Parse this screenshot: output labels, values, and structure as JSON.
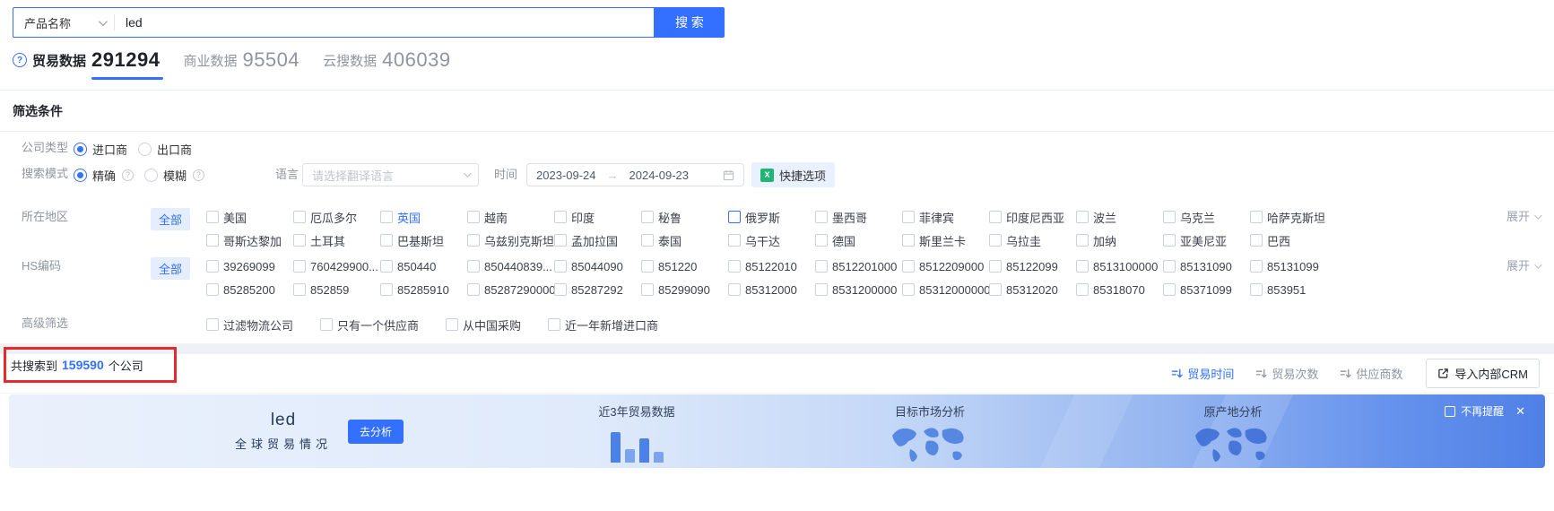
{
  "colors": {
    "primary_blue": "#3370ff",
    "annotation_red": "#e52b2b",
    "chip_bg": "#e5eefe",
    "quick_icon_green": "#21b573",
    "banner_deep_blue": "#4f80e6",
    "inactive_gray": "#8f959e"
  },
  "icons": {
    "question_circle": "?",
    "info_circle": "?",
    "excel": "X",
    "range_arrow": "→",
    "close": "✕"
  },
  "search_bar": {
    "category": "产品名称",
    "query": "led",
    "button": "搜 索"
  },
  "tabs": [
    {
      "label": "贸易数据",
      "count": "291294"
    },
    {
      "label": "商业数据",
      "count": "95504"
    },
    {
      "label": "云搜数据",
      "count": "406039"
    }
  ],
  "filters": {
    "title": "筛选条件",
    "company_type": {
      "label": "公司类型",
      "options": [
        {
          "label": "进口商",
          "cls": "on",
          "info": "hide"
        },
        {
          "label": "出口商",
          "cls": "",
          "info": "hide"
        }
      ]
    },
    "search_mode": {
      "label": "搜索模式",
      "options": [
        {
          "label": "精确",
          "cls": "on",
          "info": "show"
        },
        {
          "label": "模糊",
          "cls": "",
          "info": "show"
        }
      ]
    },
    "language": {
      "label": "语言",
      "placeholder": "请选择翻译语言"
    },
    "time": {
      "label": "时间",
      "start": "2023-09-24",
      "end": "2024-09-23"
    },
    "quick_option": "快捷选项",
    "region": {
      "label": "所在地区",
      "all": "全部",
      "expand": "展开",
      "row1": [
        {
          "label": "美国",
          "cls": ""
        },
        {
          "label": "厄瓜多尔",
          "cls": ""
        },
        {
          "label": "英国",
          "cls": "lbl-blue"
        },
        {
          "label": "越南",
          "cls": ""
        },
        {
          "label": "印度",
          "cls": ""
        },
        {
          "label": "秘鲁",
          "cls": ""
        },
        {
          "label": "俄罗斯",
          "cls": "box-blue"
        },
        {
          "label": "墨西哥",
          "cls": ""
        },
        {
          "label": "菲律宾",
          "cls": ""
        },
        {
          "label": "印度尼西亚",
          "cls": ""
        },
        {
          "label": "波兰",
          "cls": ""
        },
        {
          "label": "乌克兰",
          "cls": ""
        },
        {
          "label": "哈萨克斯坦",
          "cls": ""
        }
      ],
      "row2": [
        {
          "label": "哥斯达黎加",
          "cls": ""
        },
        {
          "label": "土耳其",
          "cls": ""
        },
        {
          "label": "巴基斯坦",
          "cls": ""
        },
        {
          "label": "乌兹别克斯坦",
          "cls": ""
        },
        {
          "label": "孟加拉国",
          "cls": ""
        },
        {
          "label": "泰国",
          "cls": ""
        },
        {
          "label": "乌干达",
          "cls": ""
        },
        {
          "label": "德国",
          "cls": ""
        },
        {
          "label": "斯里兰卡",
          "cls": ""
        },
        {
          "label": "乌拉圭",
          "cls": ""
        },
        {
          "label": "加纳",
          "cls": ""
        },
        {
          "label": "亚美尼亚",
          "cls": ""
        },
        {
          "label": "巴西",
          "cls": ""
        }
      ]
    },
    "hs_code": {
      "label": "HS编码",
      "all": "全部",
      "expand": "展开",
      "row1": [
        {
          "label": "39269099",
          "cls": ""
        },
        {
          "label": "760429900...",
          "cls": ""
        },
        {
          "label": "850440",
          "cls": ""
        },
        {
          "label": "850440839...",
          "cls": ""
        },
        {
          "label": "85044090",
          "cls": ""
        },
        {
          "label": "851220",
          "cls": ""
        },
        {
          "label": "85122010",
          "cls": ""
        },
        {
          "label": "8512201000",
          "cls": ""
        },
        {
          "label": "8512209000",
          "cls": ""
        },
        {
          "label": "85122099",
          "cls": ""
        },
        {
          "label": "8513100000",
          "cls": ""
        },
        {
          "label": "85131090",
          "cls": ""
        },
        {
          "label": "85131099",
          "cls": ""
        }
      ],
      "row2": [
        {
          "label": "85285200",
          "cls": ""
        },
        {
          "label": "852859",
          "cls": ""
        },
        {
          "label": "85285910",
          "cls": ""
        },
        {
          "label": "85287290000",
          "cls": ""
        },
        {
          "label": "85287292",
          "cls": ""
        },
        {
          "label": "85299090",
          "cls": ""
        },
        {
          "label": "85312000",
          "cls": ""
        },
        {
          "label": "8531200000",
          "cls": ""
        },
        {
          "label": "85312000000",
          "cls": ""
        },
        {
          "label": "85312020",
          "cls": ""
        },
        {
          "label": "85318070",
          "cls": ""
        },
        {
          "label": "85371099",
          "cls": ""
        },
        {
          "label": "853951",
          "cls": ""
        }
      ]
    },
    "advanced": {
      "label": "高级筛选",
      "options": [
        {
          "label": "过滤物流公司",
          "cls": ""
        },
        {
          "label": "只有一个供应商",
          "cls": ""
        },
        {
          "label": "从中国采购",
          "cls": ""
        },
        {
          "label": "近一年新增进口商",
          "cls": ""
        }
      ]
    }
  },
  "results": {
    "prefix": "共搜索到",
    "count": "159590",
    "suffix": "个公司",
    "sorts": [
      {
        "label": "贸易时间",
        "cls": "active"
      },
      {
        "label": "贸易次数",
        "cls": ""
      },
      {
        "label": "供应商数",
        "cls": ""
      }
    ],
    "crm_button": "导入内部CRM"
  },
  "banner": {
    "keyword": "led",
    "subtitle": "全球贸易情况",
    "analyze_button": "去分析",
    "cards": [
      "近3年贸易数据",
      "目标市场分析",
      "原产地分析"
    ],
    "dismiss": "不再提醒"
  }
}
